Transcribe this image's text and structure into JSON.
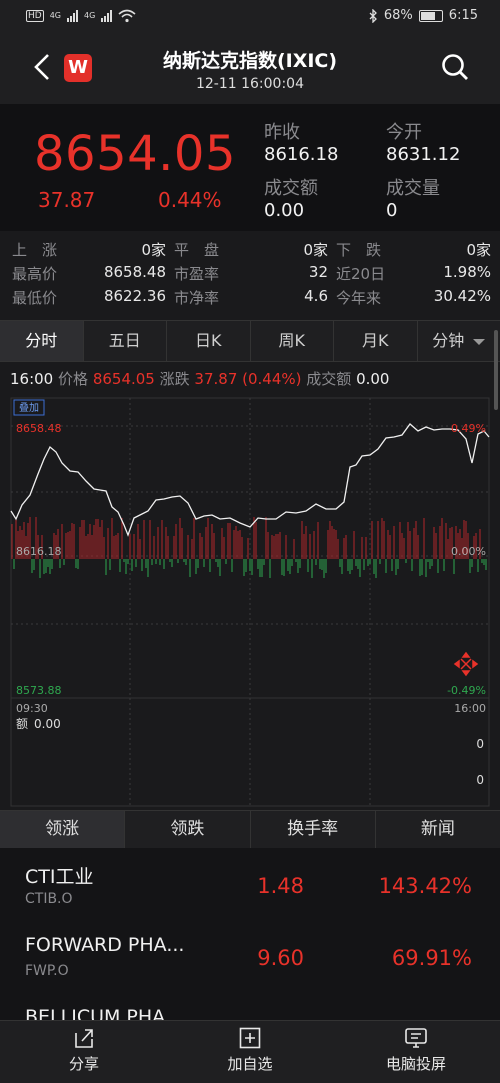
{
  "status_bar": {
    "signal1": "4G",
    "signal2": "4G",
    "battery": "68%",
    "time": "6:15"
  },
  "header": {
    "title": "纳斯达克指数(IXIC)",
    "subtitle": "12-11 16:00:04",
    "logo_letter": "W"
  },
  "quote": {
    "price": "8654.05",
    "change": "37.87",
    "change_pct": "0.44%",
    "prev_close_label": "昨收",
    "prev_close": "8616.18",
    "open_label": "今开",
    "open": "8631.12",
    "turnover_label": "成交额",
    "turnover": "0.00",
    "volume_label": "成交量",
    "volume": "0"
  },
  "stats": {
    "row1": {
      "l1": "上　涨",
      "v1": "0家",
      "l2": "平　盘",
      "v2": "0家",
      "l3": "下　跌",
      "v3": "0家"
    },
    "row2": {
      "l1": "最高价",
      "v1": "8658.48",
      "l2": "市盈率",
      "v2": "32",
      "l3": "近20日",
      "v3": "1.98%"
    },
    "row3": {
      "l1": "最低价",
      "v1": "8622.36",
      "l2": "市净率",
      "v2": "4.6",
      "l3": "今年来",
      "v3": "30.42%"
    }
  },
  "period_tabs": [
    "分时",
    "五日",
    "日K",
    "周K",
    "月K",
    "分钟"
  ],
  "info_line": {
    "time": "16:00",
    "price_label": "价格",
    "price": "8654.05",
    "change_label": "涨跌",
    "change": "37.87 (0.44%)",
    "turnover_label": "成交额",
    "turnover": "0.00"
  },
  "chart_labels": {
    "overlay": "叠加",
    "high": "8658.48",
    "high_pct": "0.49%",
    "mid": "8616.18",
    "mid_pct": "0.00%",
    "low": "8573.88",
    "low_pct": "-0.49%",
    "start_time": "09:30",
    "end_time": "16:00",
    "amount_label": "额",
    "amount": "0.00",
    "vol_axis_top": "0",
    "vol_axis_bottom": "0"
  },
  "list_tabs": [
    "领涨",
    "领跌",
    "换手率",
    "新闻"
  ],
  "stocks": [
    {
      "name": "CTI工业",
      "code": "CTIB.O",
      "price": "1.48",
      "pct": "143.42%"
    },
    {
      "name": "FORWARD PHA...",
      "code": "FWP.O",
      "price": "9.60",
      "pct": "69.91%"
    },
    {
      "name": "BELLICUM PHA",
      "code": "",
      "price": "",
      "pct": ""
    }
  ],
  "bottom_bar": {
    "share": "分享",
    "add": "加自选",
    "cast": "电脑投屏"
  },
  "colors": {
    "up": "#e8322a",
    "down": "#2fa84f",
    "background": "#1a1a1c"
  }
}
